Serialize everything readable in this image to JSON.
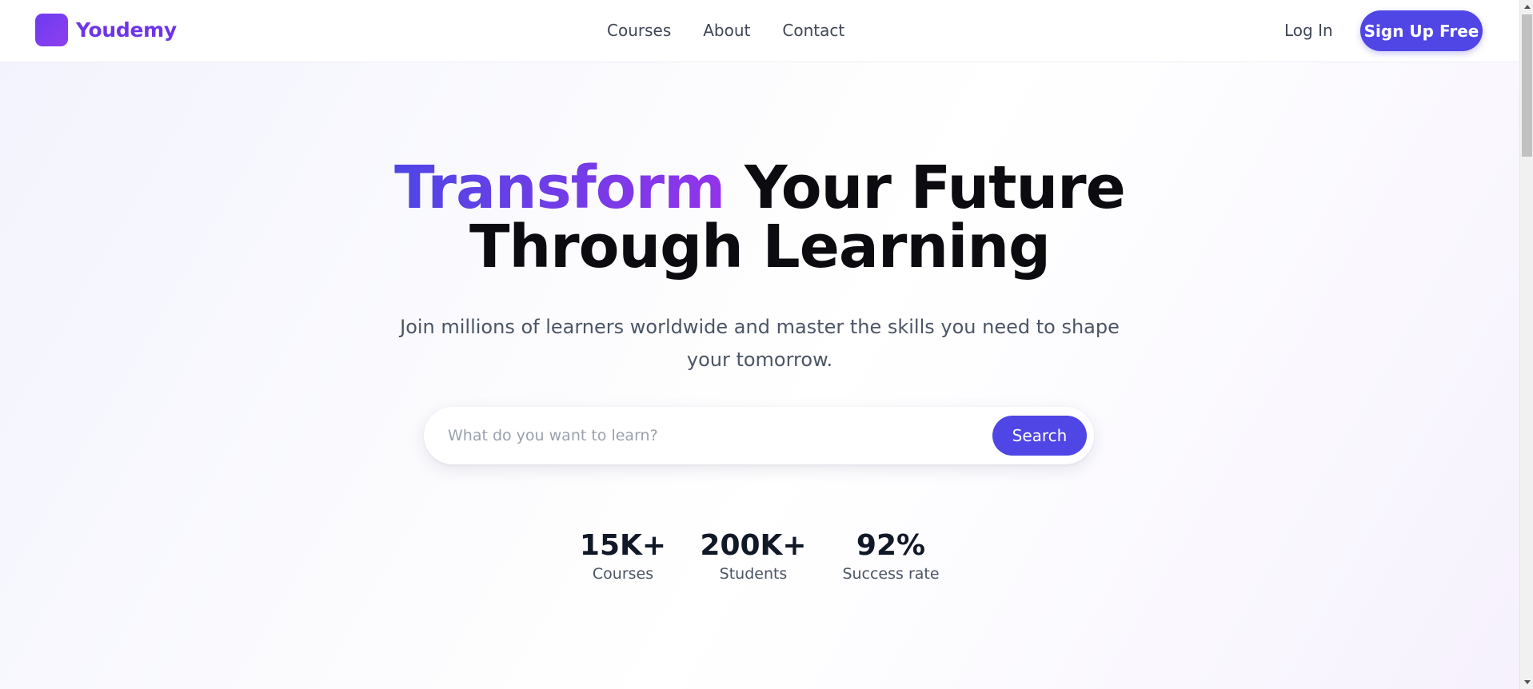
{
  "brand": {
    "name": "Youdemy",
    "logo_icon": "logo-square-icon",
    "colors": {
      "primary": "#4f46e5",
      "accent_end": "#9333ea",
      "logo_text": "#6e35e8"
    }
  },
  "nav": {
    "links": [
      "Courses",
      "About",
      "Contact"
    ],
    "login_label": "Log In",
    "signup_label": "Sign Up Free"
  },
  "hero": {
    "title_accent": "Transform",
    "title_rest_line1": " Your Future",
    "title_line2": "Through Learning",
    "subtitle": "Join millions of learners worldwide and master the skills you need to shape your tomorrow."
  },
  "search": {
    "placeholder": "What do you want to learn?",
    "value": "",
    "button_label": "Search"
  },
  "stats": [
    {
      "value": "15K+",
      "label": "Courses"
    },
    {
      "value": "200K+",
      "label": "Students"
    },
    {
      "value": "92%",
      "label": "Success rate"
    }
  ]
}
